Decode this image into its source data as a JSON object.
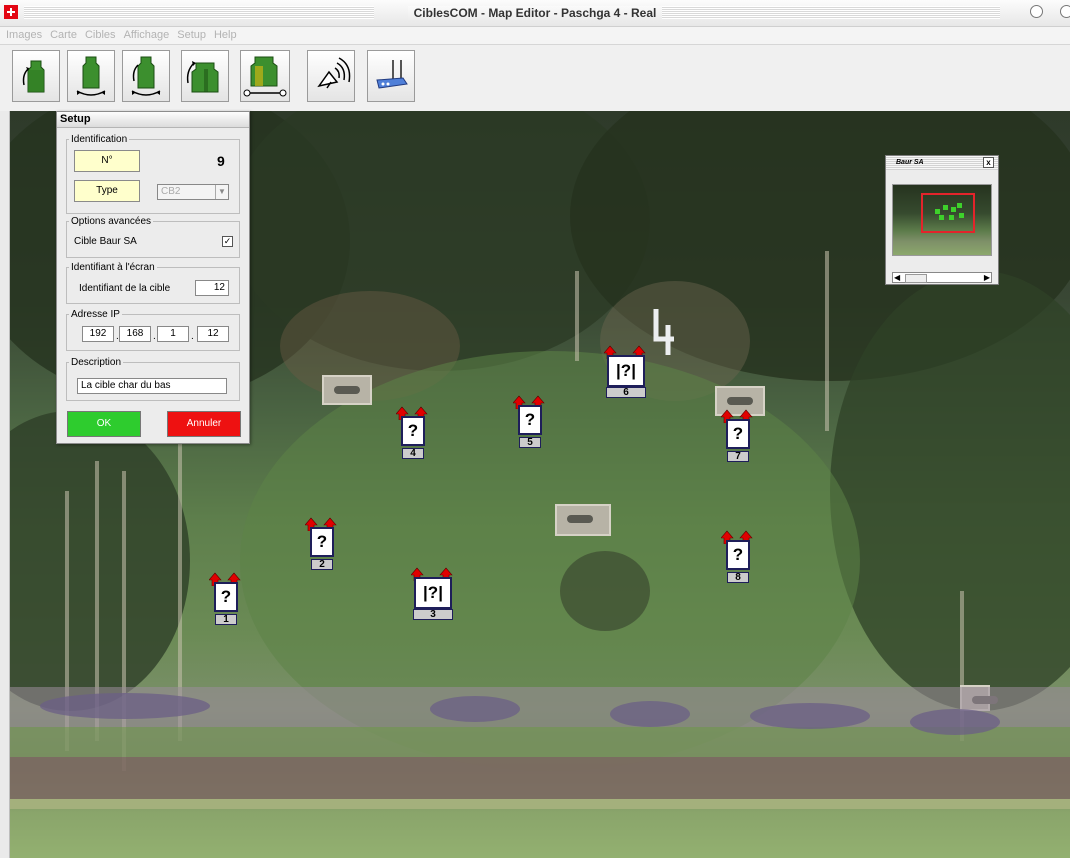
{
  "window": {
    "title": "CiblesCOM - Map Editor - Paschga 4 - Real"
  },
  "menu": [
    "Images",
    "Carte",
    "Cibles",
    "Affichage",
    "Setup",
    "Help"
  ],
  "toolbar": [
    {
      "name": "rotate-target-left-button",
      "icon": "rotate-target-icon"
    },
    {
      "name": "move-target-button",
      "icon": "target-move-icon"
    },
    {
      "name": "rotate-move-target-button",
      "icon": "target-rotate-move-icon"
    },
    {
      "name": "rotate-group-button",
      "icon": "group-rotate-icon"
    },
    {
      "name": "group-on-rail-button",
      "icon": "group-rail-icon"
    },
    {
      "name": "wireless-button",
      "icon": "antenna-icon"
    },
    {
      "name": "router-button",
      "icon": "router-icon"
    }
  ],
  "setup": {
    "title": "Setup",
    "identification": {
      "legend": "Identification",
      "number_label": "N°",
      "number_value": "9",
      "type_label": "Type",
      "type_value": "CB2"
    },
    "advanced": {
      "legend": "Options avancées",
      "baur_label": "Cible Baur SA",
      "baur_checked": true
    },
    "screen_id": {
      "legend": "Identifiant à l'écran",
      "label": "Identifiant de la cible",
      "value": "12"
    },
    "ip": {
      "legend": "Adresse IP",
      "octets": [
        "192",
        "168",
        "1",
        "12"
      ]
    },
    "description": {
      "legend": "Description",
      "value": "La cible char du bas"
    },
    "ok_label": "OK",
    "cancel_label": "Annuler",
    "ok_color": "#2ecc2e",
    "cancel_color": "#ee1111"
  },
  "overview": {
    "title": "Baur SA",
    "close_label": "x"
  },
  "targets": [
    {
      "number": "1",
      "symbol": "?"
    },
    {
      "number": "2",
      "symbol": "?"
    },
    {
      "number": "3",
      "symbol": "|?|"
    },
    {
      "number": "4",
      "symbol": "?"
    },
    {
      "number": "5",
      "symbol": "?"
    },
    {
      "number": "6",
      "symbol": "|?|"
    },
    {
      "number": "7",
      "symbol": "?"
    },
    {
      "number": "8",
      "symbol": "?"
    }
  ],
  "colors": {
    "arrow": "#e00000",
    "target_border": "#1e1e5a",
    "overview_rect": "#e3242b",
    "thumb_marker": "#3ed12b"
  }
}
